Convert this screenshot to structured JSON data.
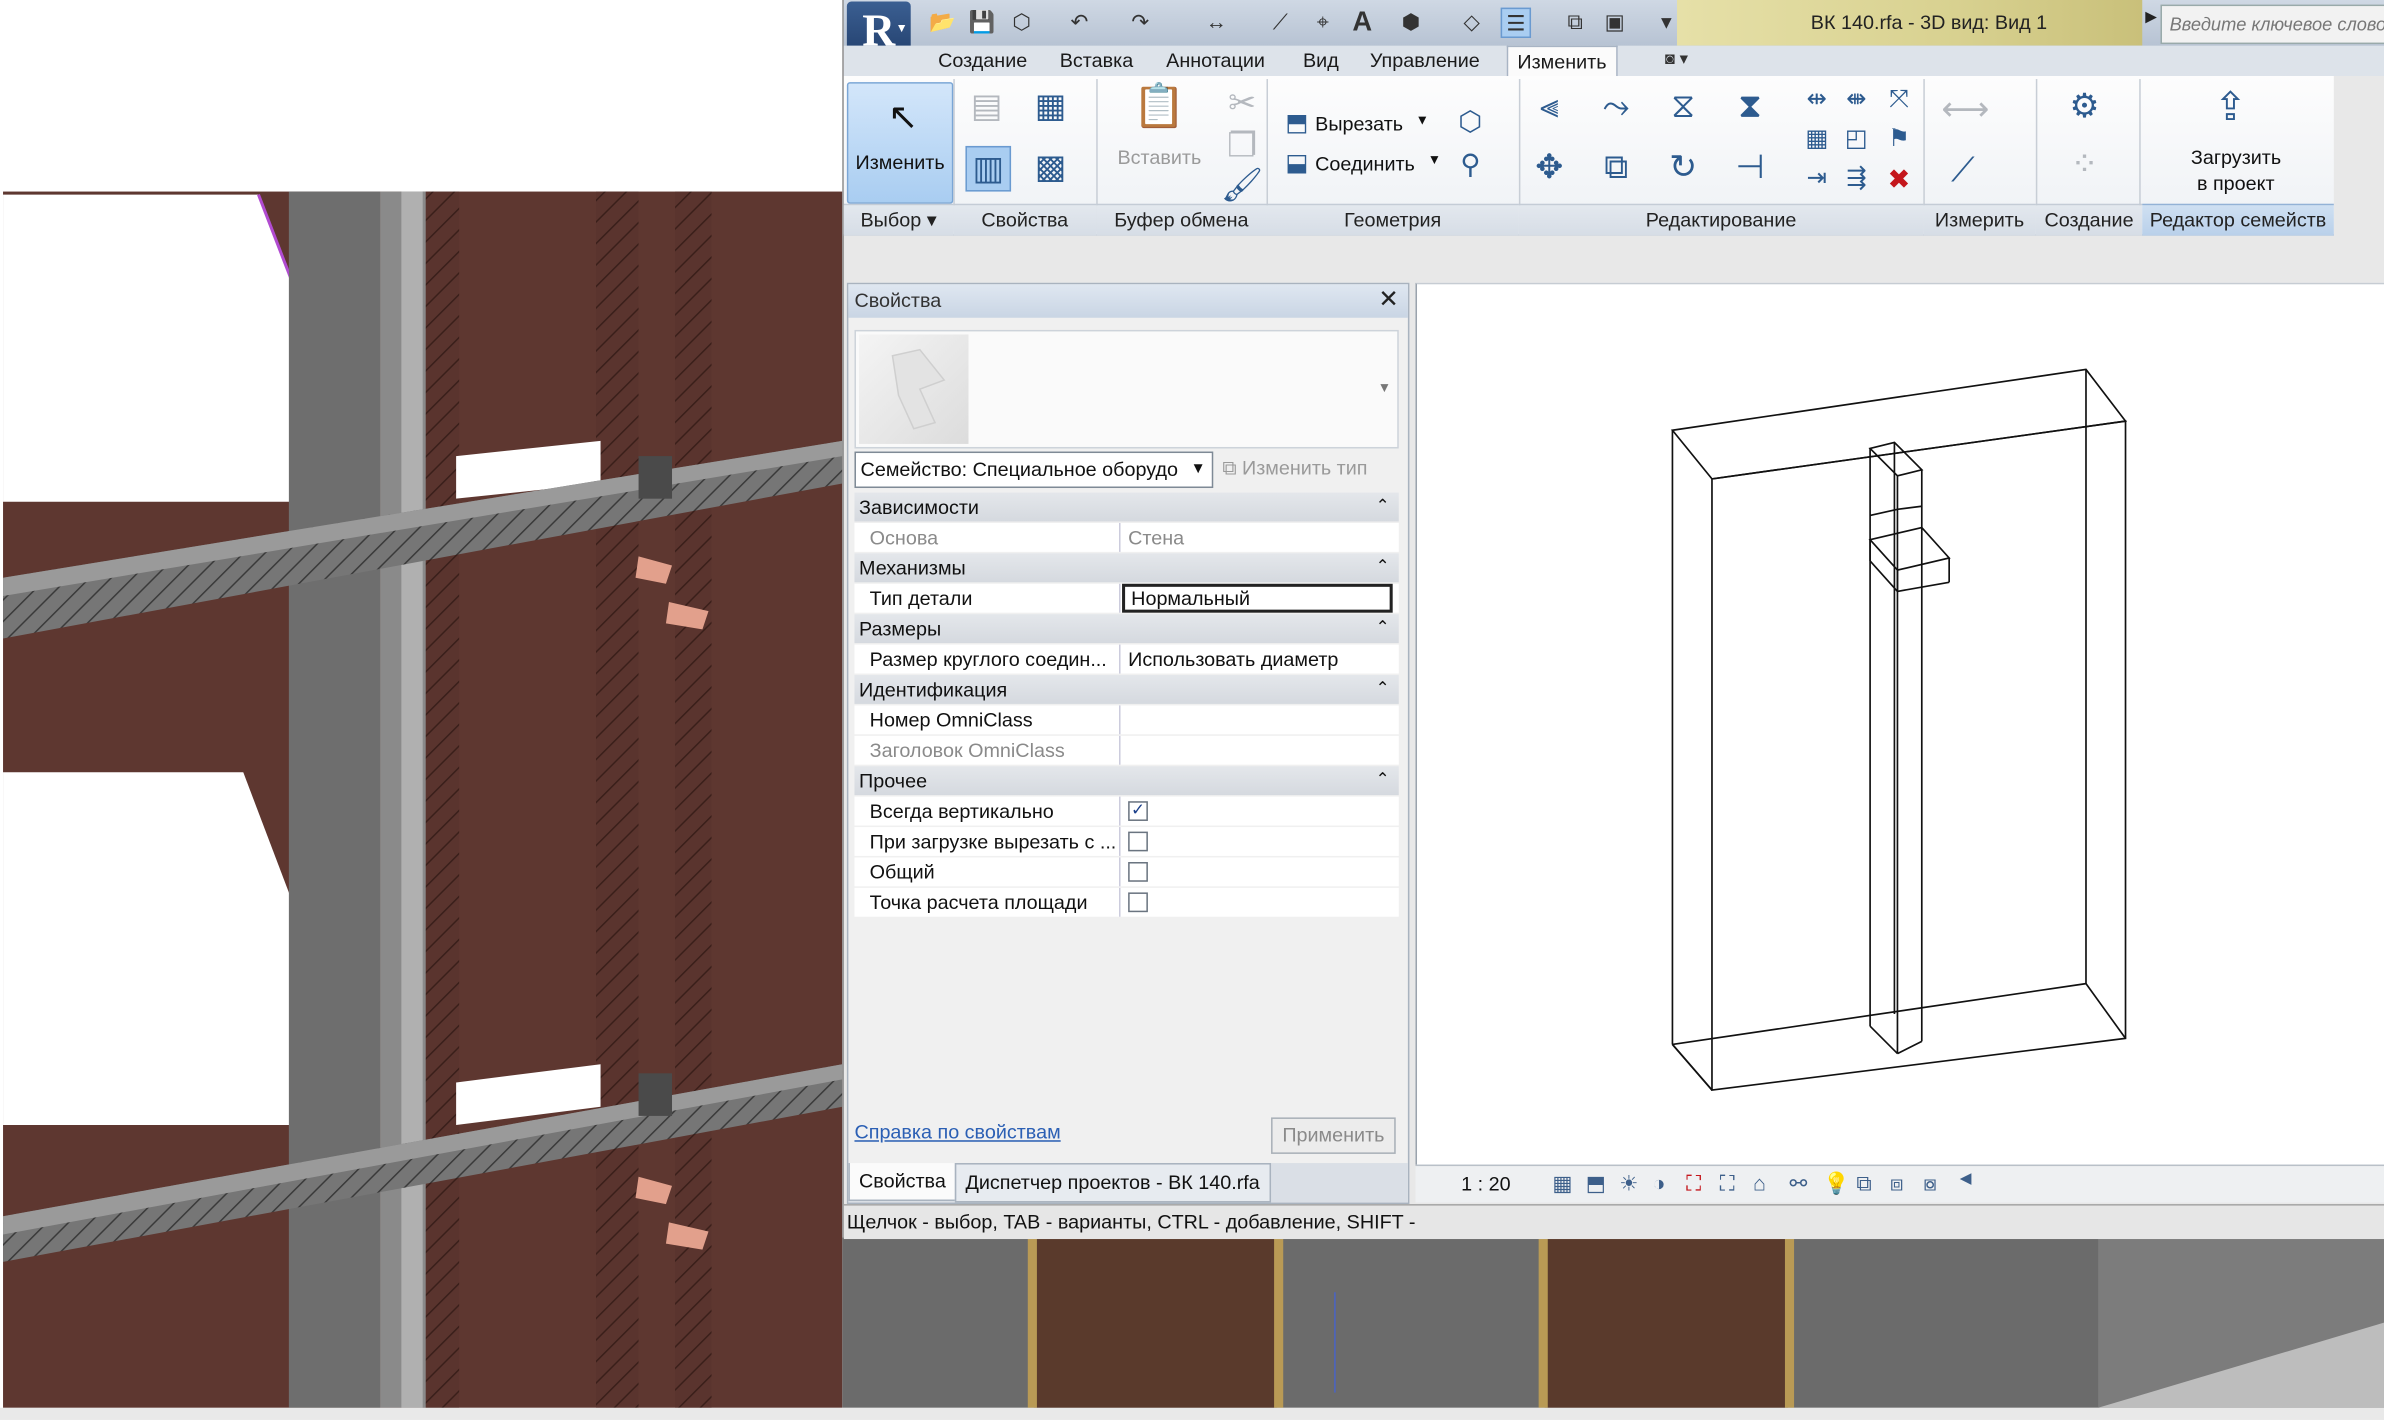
{
  "app": {
    "logo_letter": "R",
    "window_title": "ВК 140.rfa - 3D вид: Вид 1",
    "search_placeholder": "Введите ключевое слово"
  },
  "tabs": [
    {
      "label": "Создание"
    },
    {
      "label": "Вставка"
    },
    {
      "label": "Аннотации"
    },
    {
      "label": "Вид"
    },
    {
      "label": "Управление"
    },
    {
      "label": "Изменить",
      "active": true
    }
  ],
  "ribbon": {
    "modify_label": "Изменить",
    "paste_label": "Вставить",
    "cut_label": "Вырезать",
    "join_label": "Соединить",
    "load_label_1": "Загрузить",
    "load_label_2": "в проект",
    "panels": {
      "select": "Выбор",
      "properties": "Свойства",
      "clipboard": "Буфер обмена",
      "geometry": "Геометрия",
      "modify": "Редактирование",
      "measure": "Измерить",
      "create": "Создание",
      "family_editor": "Редактор семейств"
    }
  },
  "properties": {
    "title": "Свойства",
    "family_select": "Семейство: Специальное оборудо",
    "edit_type": "Изменить тип",
    "groups": [
      {
        "name": "Зависимости",
        "rows": [
          {
            "k": "Основа",
            "v": "Стена",
            "disabled": true
          }
        ]
      },
      {
        "name": "Механизмы",
        "rows": [
          {
            "k": "Тип детали",
            "v": "Нормальный",
            "boxed": true
          }
        ]
      },
      {
        "name": "Размеры",
        "rows": [
          {
            "k": "Размер круглого соедин...",
            "v": "Использовать диаметр"
          }
        ]
      },
      {
        "name": "Идентификация",
        "rows": [
          {
            "k": "Номер OmniClass",
            "v": ""
          },
          {
            "k": "Заголовок OmniClass",
            "v": "",
            "disabled": true
          }
        ]
      },
      {
        "name": "Прочее",
        "rows": [
          {
            "k": "Всегда вертикально",
            "check": true
          },
          {
            "k": "При загрузке вырезать с ...",
            "check": false
          },
          {
            "k": "Общий",
            "check": false
          },
          {
            "k": "Точка расчета площади",
            "check": false
          }
        ]
      }
    ],
    "help_link": "Справка по свойствам",
    "apply": "Применить",
    "bottom_tabs": [
      "Свойства",
      "Диспетчер проектов - ВК 140.rfa"
    ]
  },
  "view": {
    "scale": "1 : 20"
  },
  "status_text": "Щелчок - выбор, TAB - варианты, CTRL - добавление, SHIFT - ",
  "colors": {
    "brick": "#5e3730",
    "modify_active": "#a9cdf1",
    "title_bg": "#d8d190"
  }
}
